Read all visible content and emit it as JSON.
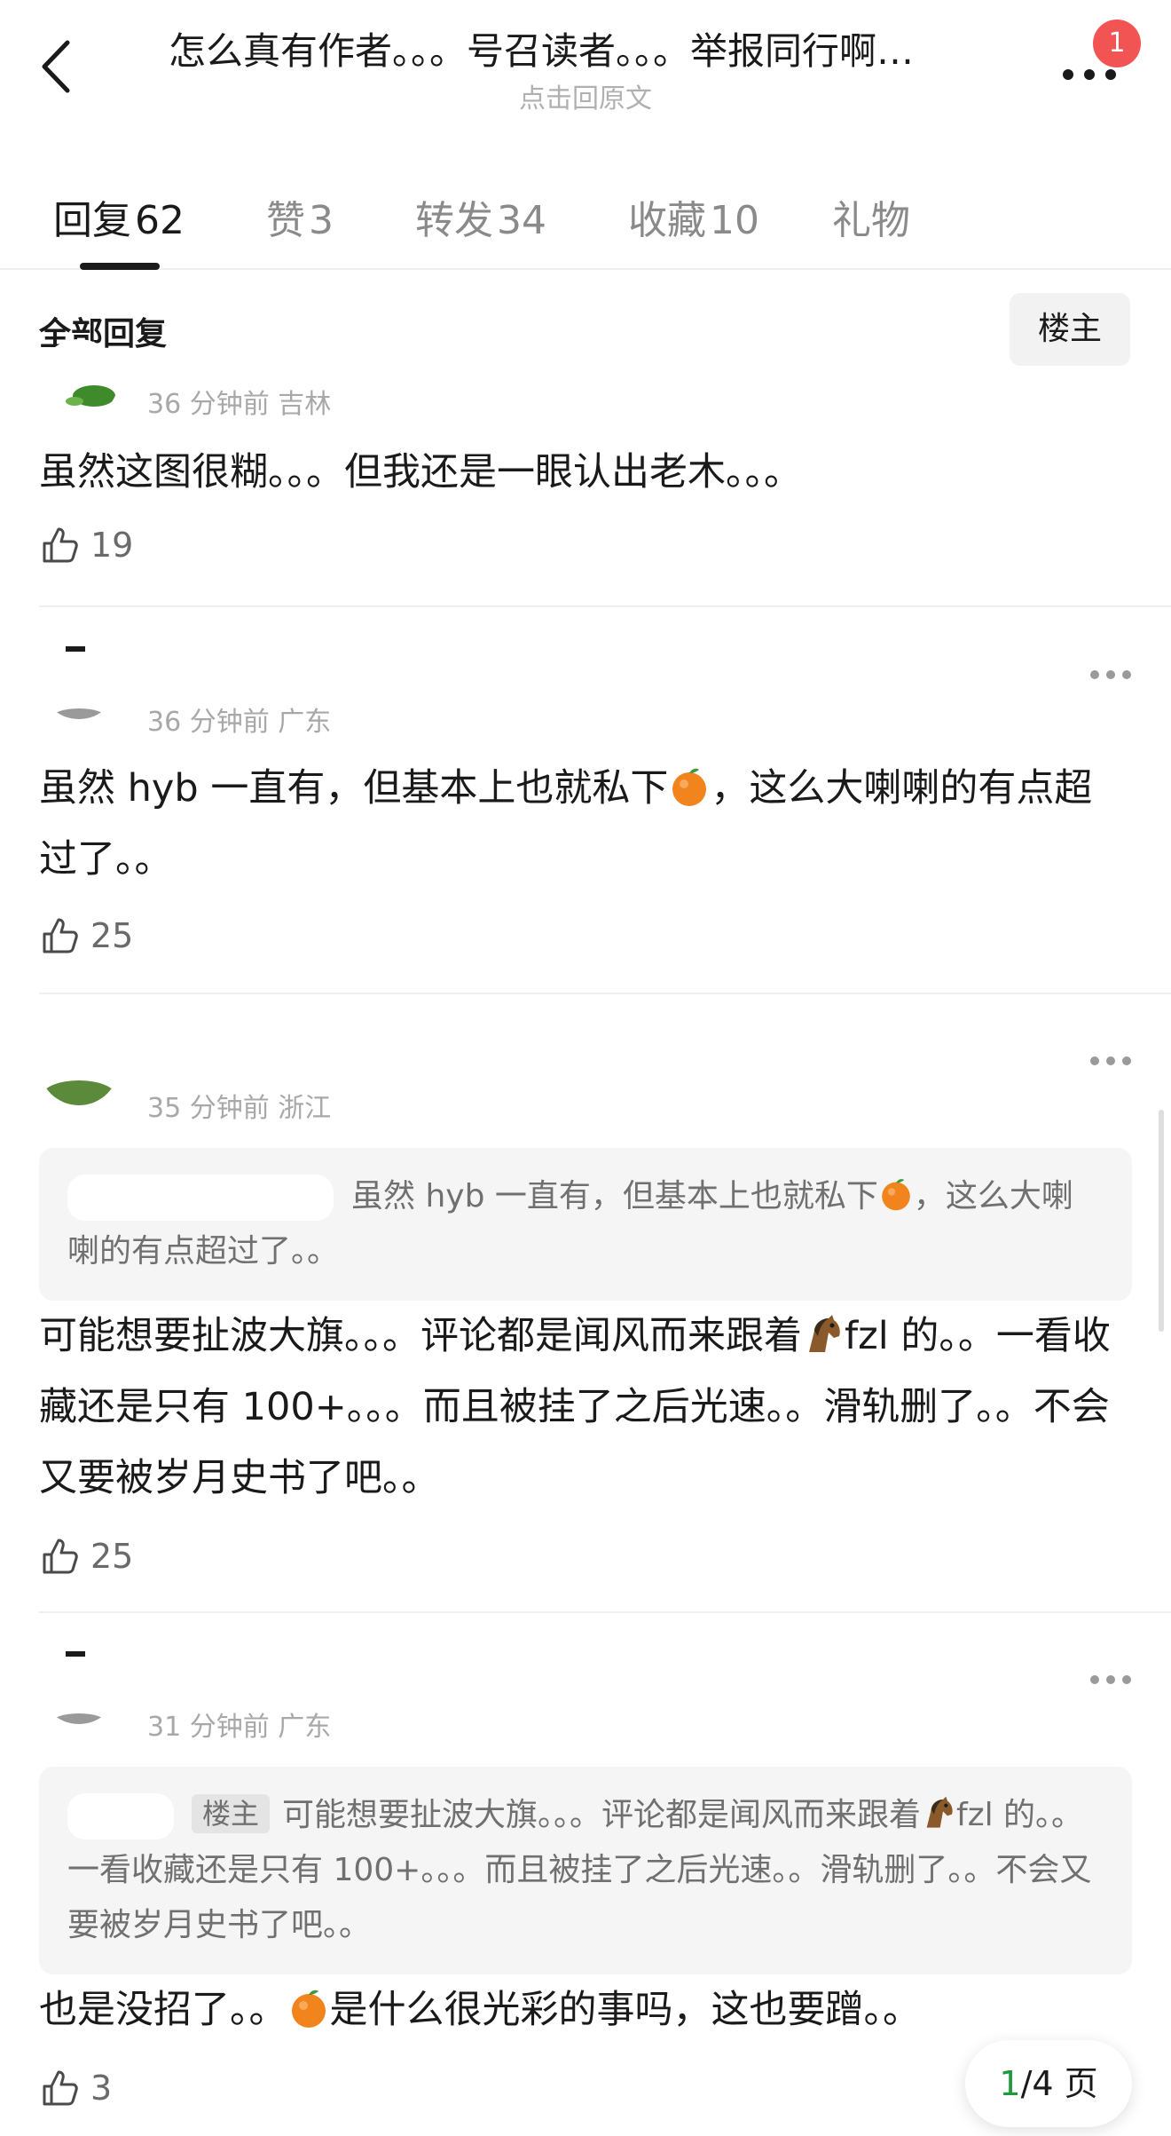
{
  "header": {
    "title": "怎么真有作者。。。号召读者。。。举报同行啊…",
    "subtitle": "点击回原文",
    "badge_count": "1"
  },
  "tabs": [
    {
      "label": "回复",
      "count": "62",
      "active": true
    },
    {
      "label": "赞",
      "count": "3",
      "active": false
    },
    {
      "label": "转发",
      "count": "34",
      "active": false
    },
    {
      "label": "收藏",
      "count": "10",
      "active": false
    },
    {
      "label": "礼物",
      "count": "",
      "active": false
    }
  ],
  "filter": {
    "label": "全部回复",
    "button": "楼主"
  },
  "comments": [
    {
      "meta": "36 分钟前  吉林",
      "text": "虽然这图很糊。。。但我还是一眼认出老木。。。",
      "likes": "19"
    },
    {
      "meta": "36 分钟前  广东",
      "text_a": "虽然 hyb 一直有，但基本上也就私下",
      "text_b": "，这么大喇喇的有点超过了。。",
      "likes": "25"
    },
    {
      "meta": "35 分钟前  浙江",
      "quote_a": "虽然 hyb 一直有，但基本上也就私下",
      "quote_b": "，这么大喇喇的有点超过了。。",
      "text_a": "可能想要扯波大旗。。。评论都是闻风而来跟着",
      "text_b": "fzl 的。。一看收藏还是只有 100+。。。而且被挂了之后光速。。滑轨删了。。不会又要被岁月史书了吧。。",
      "likes": "25"
    },
    {
      "meta": "31 分钟前  广东",
      "quote_tag": "楼主",
      "quote_a": "可能想要扯波大旗。。。评论都是闻风而来跟着",
      "quote_b": "fzl 的。。一看收藏还是只有 100+。。。而且被挂了之后光速。。滑轨删了。。不会又要被岁月史书了吧。。",
      "text_a": "也是没招了。。",
      "text_b": "是什么很光彩的事吗，这也要蹭。。",
      "likes": "3"
    }
  ],
  "pager": {
    "current": "1",
    "rest": "/4 页"
  },
  "colors": {
    "accent_green": "#1f9a3a",
    "badge_red": "#f25454"
  }
}
